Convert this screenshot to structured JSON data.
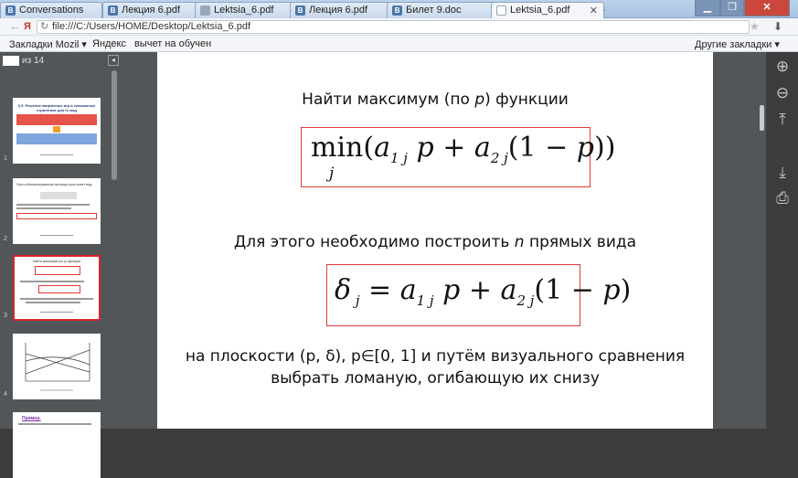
{
  "tabs": [
    {
      "label": "Conversations",
      "icon": "vk-icon",
      "color": "#4a76a8",
      "active": false
    },
    {
      "label": "Лекция 6.pdf",
      "icon": "vk-icon",
      "color": "#4a76a8",
      "active": false
    },
    {
      "label": "Lektsia_6.pdf",
      "icon": "doc-icon",
      "color": "#9aa7b6",
      "active": false
    },
    {
      "label": "Лекция 6.pdf",
      "icon": "vk-icon",
      "color": "#4a76a8",
      "active": false
    },
    {
      "label": "Билет 9.doc",
      "icon": "vk-icon",
      "color": "#4a76a8",
      "active": false
    },
    {
      "label": "Lektsia_6.pdf",
      "icon": "doc-icon",
      "color": "#9aa7b6",
      "active": true
    }
  ],
  "address": {
    "url": "file:///C:/Users/HOME/Desktop/Lektsia_6.pdf"
  },
  "bookmarks": {
    "items": [
      "Закладки Mozil",
      "Яндекс",
      "вычет на обучен"
    ],
    "other": "Другие закладки"
  },
  "sidebar": {
    "page_total": "из 14",
    "thumbnails": [
      {
        "number": "1",
        "title": "§.5. Решение матричных игр в смешанных стратегиях для m мод"
      },
      {
        "number": "2",
        "title": "Пусть сбалансированная матрица игры имеет вид:"
      },
      {
        "number": "3",
        "title": "Найти максимум (по p) функции"
      },
      {
        "number": "4",
        "title": ""
      },
      {
        "number": "",
        "title": "Пример."
      }
    ]
  },
  "slide": {
    "heading_pre": "Найти максимум (по ",
    "heading_var": "p",
    "heading_post": ") функции",
    "line2_pre": "Для этого необходимо построить ",
    "line2_var": "n",
    "line2_post": " прямых вида",
    "line3a": "на плоскости (p, δ), p∈[0, 1] и путём визуального сравнения",
    "line3b": "выбрать ломаную, огибающую их снизу"
  },
  "colors": {
    "accent_red": "#e03a3a",
    "viewer_bg": "#525659"
  }
}
